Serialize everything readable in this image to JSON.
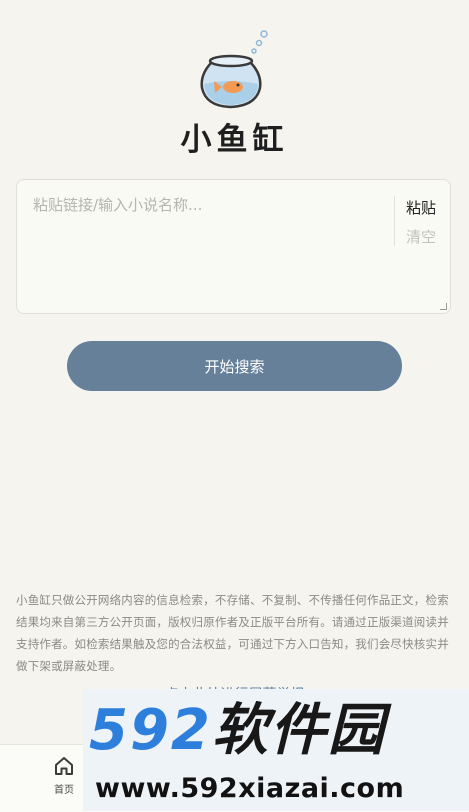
{
  "app": {
    "title": "小鱼缸",
    "logo_icon": "fishbowl-icon"
  },
  "search": {
    "placeholder": "粘贴链接/输入小说名称...",
    "paste_label": "粘贴",
    "clear_label": "清空",
    "submit_label": "开始搜索"
  },
  "disclaimer": {
    "text": "小鱼缸只做公开网络内容的信息检索，不存储、不复制、不传播任何作品正文，检索结果均来自第三方公开页面，版权归原作者及正版平台所有。请通过正版渠道阅读并支持作者。如检索结果触及您的合法权益，可通过下方入口告知，我们会尽快核实并做下架或屏蔽处理。",
    "link_label": "点击此处进行屏蔽举报"
  },
  "nav": {
    "home_label": "首页",
    "home_icon": "home-icon"
  },
  "watermark": {
    "brand_number": "592",
    "brand_text": "软件园",
    "url": "www.592xiazai.com"
  },
  "colors": {
    "background": "#f5f4ee",
    "primary_button": "#66809a",
    "link": "#5b7fa2",
    "watermark_blue": "#2e7fdc"
  }
}
